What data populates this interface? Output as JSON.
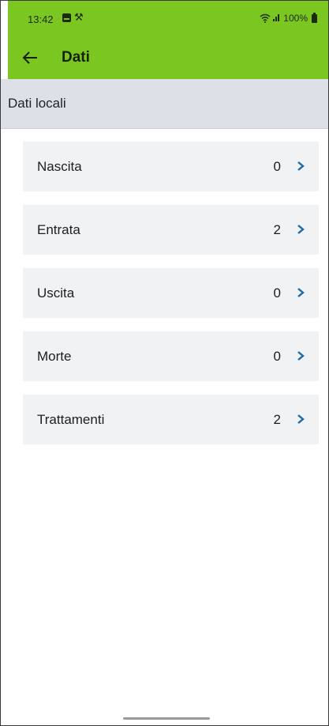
{
  "status_bar": {
    "time": "13:42",
    "battery": "100%",
    "icons": [
      "notification-image-icon",
      "wrench-icon",
      "wifi-icon",
      "signal-icon",
      "battery-icon"
    ]
  },
  "app_bar": {
    "title": "Dati",
    "back_icon": "back-arrow-icon",
    "background_color": "#7cc622"
  },
  "section": {
    "title": "Dati locali"
  },
  "items": [
    {
      "label": "Nascita",
      "count": "0"
    },
    {
      "label": "Entrata",
      "count": "2"
    },
    {
      "label": "Uscita",
      "count": "0"
    },
    {
      "label": "Morte",
      "count": "0"
    },
    {
      "label": "Trattamenti",
      "count": "2"
    }
  ],
  "colors": {
    "accent": "#7cc622",
    "chevron": "#1f6aa8",
    "list_item_bg": "#f1f2f4",
    "section_bg": "#dde0e6"
  }
}
